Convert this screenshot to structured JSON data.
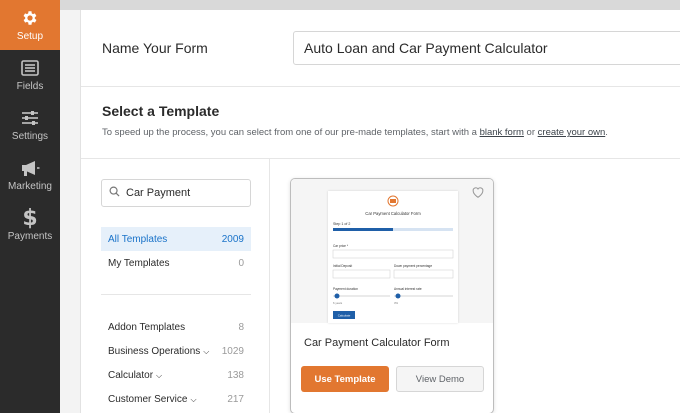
{
  "sidebar": {
    "items": [
      {
        "label": "Setup",
        "icon": "gear-icon",
        "active": true
      },
      {
        "label": "Fields",
        "icon": "list-icon",
        "active": false
      },
      {
        "label": "Settings",
        "icon": "sliders-icon",
        "active": false
      },
      {
        "label": "Marketing",
        "icon": "megaphone-icon",
        "active": false
      },
      {
        "label": "Payments",
        "icon": "dollar-icon",
        "active": false
      }
    ]
  },
  "form_name": {
    "label": "Name Your Form",
    "value": "Auto Loan and Car Payment Calculator"
  },
  "templates": {
    "heading": "Select a Template",
    "description_start": "To speed up the process, you can select from one of our pre-made templates, start with a ",
    "blank_form_link": "blank form",
    "description_middle": " or ",
    "create_own_link": "create your own",
    "description_end": ".",
    "search_value": "Car Payment",
    "categories_top": [
      {
        "label": "All Templates",
        "count": "2009",
        "active": true
      },
      {
        "label": "My Templates",
        "count": "0",
        "active": false
      }
    ],
    "categories": [
      {
        "label": "Addon Templates",
        "count": "8",
        "expandable": false
      },
      {
        "label": "Business Operations",
        "count": "1029",
        "expandable": true
      },
      {
        "label": "Calculator",
        "count": "138",
        "expandable": true
      },
      {
        "label": "Customer Service",
        "count": "217",
        "expandable": true
      }
    ]
  },
  "card": {
    "title": "Car Payment Calculator Form",
    "use_label": "Use Template",
    "demo_label": "View Demo",
    "preview": {
      "title": "Car Payment Calculator Form",
      "step": "Step 1 of 2",
      "progress": 0.5,
      "field_car_price": "Car price *",
      "field_initial_deposit": "Initial Deposit",
      "field_down_payment": "Down payment percentage",
      "field_payment_duration": "Payment duration",
      "field_interest_rate": "Annual interest rate",
      "slider_left_value": "6 years",
      "slider_right_value": "3%",
      "button": "Calculate"
    }
  },
  "colors": {
    "accent": "#e27730",
    "sidebar_bg": "#2b2b2b",
    "active_filter_bg": "#e6f0fa",
    "active_filter_text": "#1a73c9",
    "preview_blue": "#1f5fa8"
  }
}
